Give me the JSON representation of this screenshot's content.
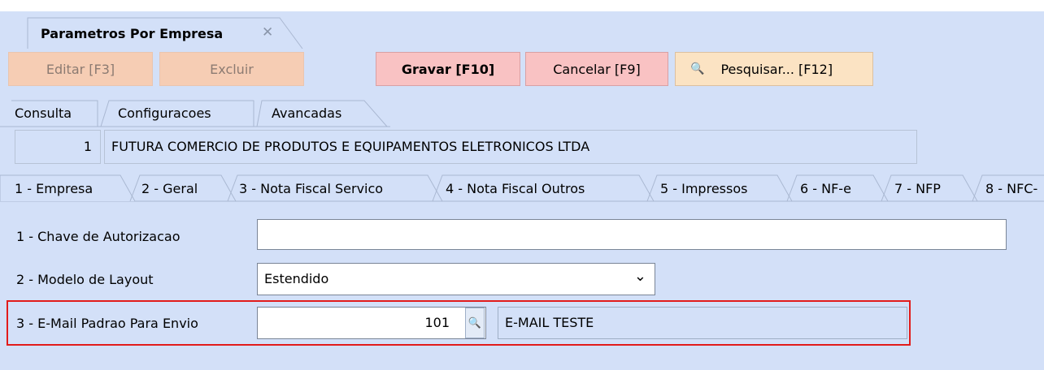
{
  "window": {
    "doc_tab": "Parametros Por Empresa",
    "close_glyph": "✕"
  },
  "toolbar": {
    "editar": "Editar [F3]",
    "excluir": "Excluir",
    "gravar": "Gravar [F10]",
    "cancelar": "Cancelar [F9]",
    "pesquisar": "Pesquisar... [F12]",
    "pesquisar_icon": "magnifier-icon"
  },
  "view_tabs": [
    "Consulta",
    "Configuracoes",
    "Avancadas"
  ],
  "company": {
    "code": "1",
    "name": "FUTURA COMERCIO DE PRODUTOS E EQUIPAMENTOS ELETRONICOS LTDA"
  },
  "section_tabs": [
    "1 - Empresa",
    "2 - Geral",
    "3 - Nota Fiscal Servico",
    "4 - Nota Fiscal Outros",
    "5 - Impressos",
    "6 - NF-e",
    "7 - NFP",
    "8 - NFC-"
  ],
  "fields": {
    "chave_label": "1 - Chave de Autorizacao",
    "chave_value": "",
    "modelo_label": "2 - Modelo de Layout",
    "modelo_value": "Estendido",
    "email_label": "3 - E-Mail Padrao Para Envio",
    "email_code": "101",
    "email_desc": "E-MAIL TESTE"
  },
  "colors": {
    "background": "#d3e0f8",
    "highlight_border": "#e21b1b",
    "save_bg": "#f9c2c3",
    "disabled_bg": "#f6cdb4"
  }
}
